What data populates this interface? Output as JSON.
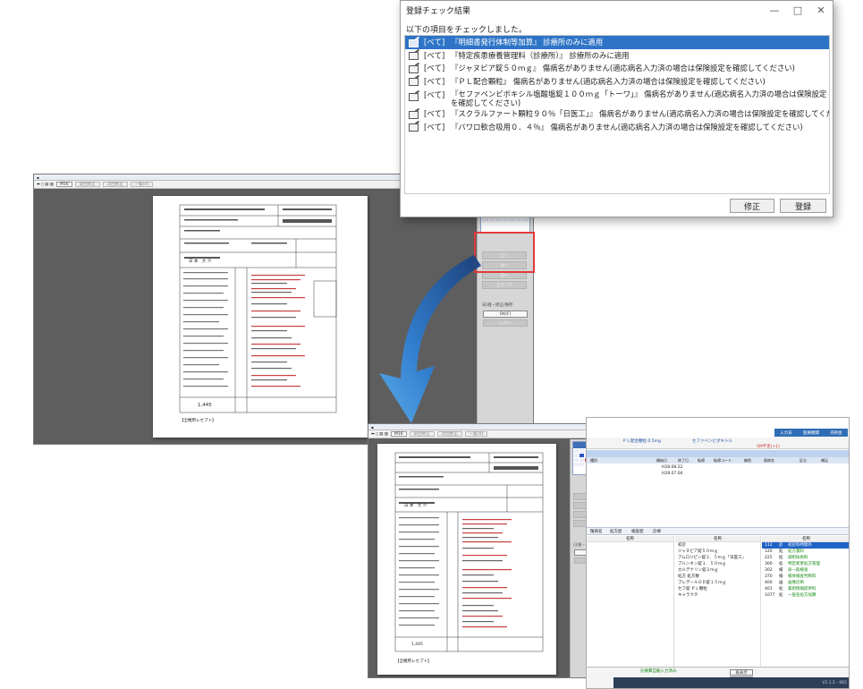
{
  "dialog": {
    "title": "登録チェック結果",
    "intro": "以下の項目をチェックしました。",
    "controls": {
      "minimize": "—",
      "maximize": "□",
      "close": "✕"
    },
    "rows": [
      {
        "tag": "[ベて]",
        "message": "『明細書発行体制等加算』 診療所のみに適用",
        "selected": true
      },
      {
        "tag": "[ベて]",
        "message": "『特定疾患療養管理料（診療所）』 診療所のみに適用",
        "selected": false
      },
      {
        "tag": "[ベて]",
        "message": "『ジャヌビア錠５０ｍｇ』 傷病名がありません(適応病名入力済の場合は保険設定を確認してください)",
        "selected": false
      },
      {
        "tag": "[ベて]",
        "message": "『ＰＬ配合顆粒』 傷病名がありません(適応病名入力済の場合は保険設定を確認してください)",
        "selected": false
      },
      {
        "tag": "[ベて]",
        "message": "『セファベンビボキシル塩酸塩錠１００ｍｇ「トーワ」』 傷病名がありません(適応病名入力済の場合は保険設定を確認してください)",
        "selected": false
      },
      {
        "tag": "[ベて]",
        "message": "『スクラルファート顆粒９０％「日医工」』 傷病名がありません(適応病名入力済の場合は保険設定を確認してください)",
        "selected": false
      },
      {
        "tag": "[ベて]",
        "message": "『バワロ軟合吸用０．４％』 傷病名がありません(適応病名入力済の場合は保険設定を確認してください)",
        "selected": false
      }
    ],
    "buttons": {
      "fix": "修正",
      "register": "登録"
    }
  },
  "viewer_large": {
    "toolbar": {
      "page_box": "M16",
      "btn_prev": "前回修正",
      "btn_next": "次回修正",
      "btn_list": "一覧(X)"
    },
    "paper": {
      "patient": "日 本　大 介",
      "total": "1,445",
      "footer": "【全機用レセプト】"
    },
    "side": {
      "buttons": [
        "全て",
        "後へ",
        "前へ",
        "全クリア"
      ],
      "note": "日/週・修正/保存",
      "btn_ok": "OK(F)",
      "btn_cancel": "しない"
    }
  },
  "viewer_small": {
    "toolbar": {
      "page_box": "M16",
      "btn_prev": "前回修正",
      "btn_next": "次回修正",
      "btn_list": "一覧(X)"
    },
    "paper": {
      "patient": "日 本　大 介",
      "total": "1,445",
      "footer": "【全機用レセプト】"
    },
    "side": {
      "buttons": [
        "全て",
        "後へ",
        "前へ",
        "全クリア"
      ],
      "note": "日/週・修正/保存",
      "btn_ok": "OK(F)",
      "btn_cancel": "しない"
    }
  },
  "app": {
    "header_items": [
      "入力日",
      "医療機関",
      "売掛金"
    ],
    "messages": [
      "ＰＬ配合顆粒 0.5mg",
      "セファベンビボキシル",
      "SM不足(+1)"
    ],
    "dates": [
      "H28.08.22",
      "H28.07.04"
    ],
    "columns": [
      "種別",
      "開始日",
      "終了日",
      "転帰",
      "転帰コード",
      "継続",
      "傷病名",
      "区分",
      "補足"
    ],
    "tabs": [
      "傷病名",
      "処方歴",
      "検査歴",
      "診療"
    ],
    "left_col_title": "名称",
    "mid_col_title": "名称",
    "mid_items": [
      "初診",
      "ジャヌビア錠５０ｍｇ",
      "アムロジピン錠２．５ｍｇ「日医工」",
      "ブルンネン錠１．５０ｍｇ",
      "カルデナリン錠２ｍｇ",
      "処方 処方数",
      "ブレデールＯＤ錠１５ｍｇ",
      "セフ錠 ＰＬ顆粒",
      "キャラクタ"
    ],
    "right_col_title": "名称",
    "right_items": [
      {
        "code": "112",
        "k": "診",
        "name": "初診料時間外"
      },
      {
        "code": "120",
        "k": "処",
        "name": "処方箋料"
      },
      {
        "code": "225",
        "k": "処",
        "name": "調剤技術料"
      },
      {
        "code": "300",
        "k": "処",
        "name": "特定疾患処方管理"
      },
      {
        "code": "302",
        "k": "検",
        "name": "尿一般検査"
      },
      {
        "code": "370",
        "k": "検",
        "name": "検体検査判断料"
      },
      {
        "code": "400",
        "k": "画",
        "name": "画像診断"
      },
      {
        "code": "401",
        "k": "処",
        "name": "薬剤情報提供料"
      },
      {
        "code": "1077",
        "k": "処",
        "name": "一般名処方加算"
      }
    ],
    "footer": {
      "btn_a": "再表示",
      "btn_b": "登録処理",
      "version": "V1.1.5 - 002"
    },
    "green_note": "診療費自動入力済み"
  }
}
